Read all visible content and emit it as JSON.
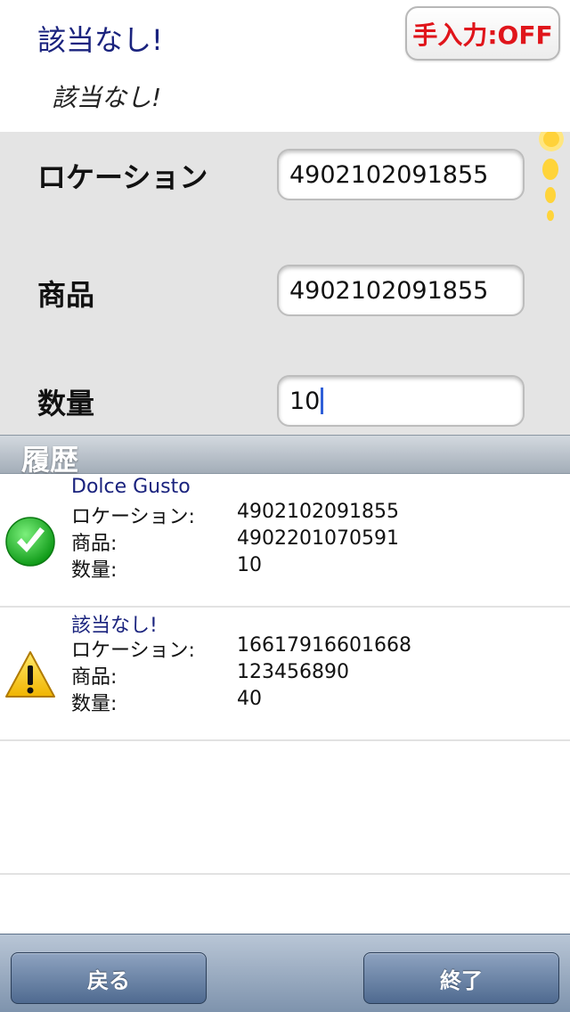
{
  "header": {
    "title": "該当なし!",
    "subtitle": "該当なし!",
    "manual_toggle_label": "手入力:OFF"
  },
  "form": {
    "location_label": "ロケーション",
    "location_value": "4902102091855",
    "product_label": "商品",
    "product_value": "4902102091855",
    "quantity_label": "数量",
    "quantity_value": "10"
  },
  "history": {
    "title": "履歴",
    "rows": [
      {
        "status_icon": "check-icon",
        "name": "Dolce Gusto",
        "location_label": "ロケーション:",
        "location_value": "4902102091855",
        "product_label": "商品:",
        "product_value": "4902201070591",
        "quantity_label": "数量:",
        "quantity_value": "10"
      },
      {
        "status_icon": "warning-icon",
        "name": "該当なし!",
        "location_label": "ロケーション:",
        "location_value": "16617916601668",
        "product_label": "商品:",
        "product_value": "123456890",
        "quantity_label": "数量:",
        "quantity_value": "40"
      }
    ]
  },
  "toolbar": {
    "back_label": "戻る",
    "finish_label": "終了"
  },
  "colors": {
    "title_blue": "#1a237e",
    "toggle_red": "#e0151b",
    "form_bg": "#e4e4e4",
    "toolbar_blue": "#4f6a90"
  }
}
